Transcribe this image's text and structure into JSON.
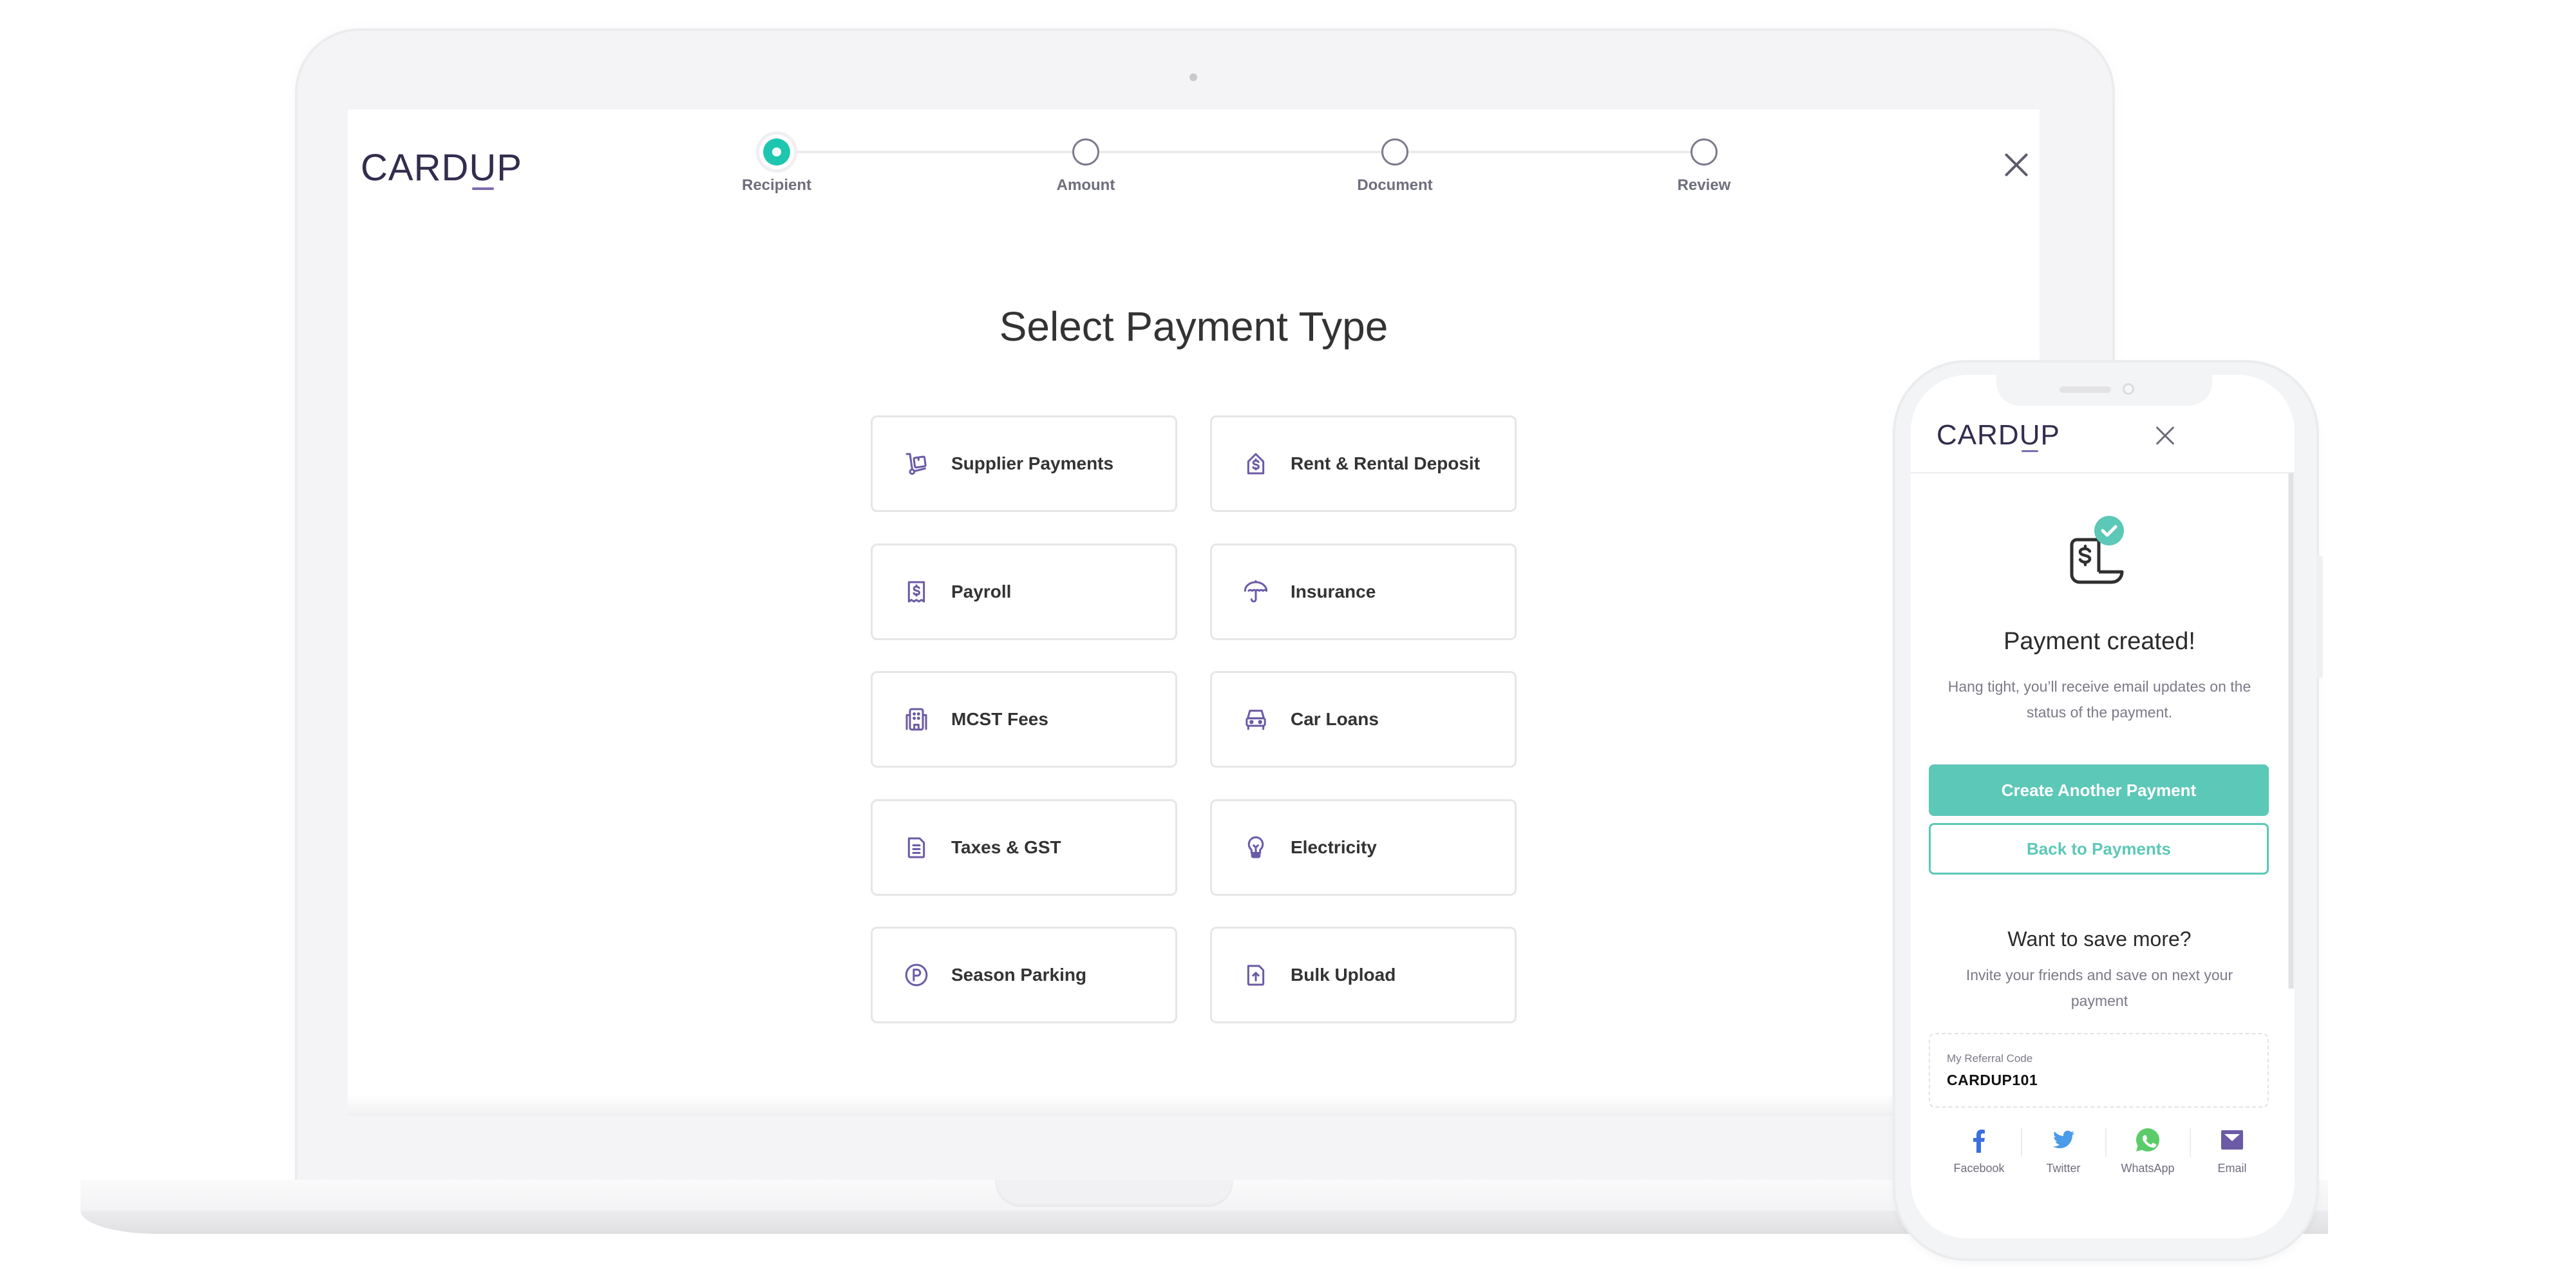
{
  "brand": {
    "logo_prefix": "CARD",
    "logo_u": "U",
    "logo_suffix": "P",
    "accent": "#1ec6b0",
    "button_teal": "#5cc8b7",
    "icon_purple": "#6b5aa6"
  },
  "desktop": {
    "stepper": {
      "steps": [
        {
          "label": "Recipient",
          "state": "active"
        },
        {
          "label": "Amount",
          "state": "pending"
        },
        {
          "label": "Document",
          "state": "pending"
        },
        {
          "label": "Review",
          "state": "pending"
        }
      ]
    },
    "close_icon": "close-icon",
    "title": "Select Payment Type",
    "payment_types": [
      {
        "label": "Supplier Payments",
        "icon": "hand-truck-icon"
      },
      {
        "label": "Rent & Rental Deposit",
        "icon": "house-dollar-icon"
      },
      {
        "label": "Payroll",
        "icon": "dollar-receipt-icon"
      },
      {
        "label": "Insurance",
        "icon": "umbrella-icon"
      },
      {
        "label": "MCST Fees",
        "icon": "building-icon"
      },
      {
        "label": "Car Loans",
        "icon": "car-icon"
      },
      {
        "label": "Taxes & GST",
        "icon": "document-icon"
      },
      {
        "label": "Electricity",
        "icon": "lightbulb-icon"
      },
      {
        "label": "Season Parking",
        "icon": "parking-icon"
      },
      {
        "label": "Bulk Upload",
        "icon": "file-upload-icon"
      }
    ]
  },
  "mobile": {
    "title": "Payment created!",
    "subtitle": "Hang tight, you’ll receive email updates on the status of the payment.",
    "primary_button": "Create Another Payment",
    "secondary_button": "Back to Payments",
    "save_title": "Want to save more?",
    "save_subtitle": "Invite your friends and save on next your payment",
    "referral": {
      "label": "My Referral Code",
      "code": "CARDUP101"
    },
    "share": [
      {
        "label": "Facebook",
        "icon": "facebook-icon",
        "color": "#3b6fe0"
      },
      {
        "label": "Twitter",
        "icon": "twitter-icon",
        "color": "#4a9be8"
      },
      {
        "label": "WhatsApp",
        "icon": "whatsapp-icon",
        "color": "#5ccc6a"
      },
      {
        "label": "Email",
        "icon": "email-icon",
        "color": "#6b5aa6"
      }
    ]
  }
}
